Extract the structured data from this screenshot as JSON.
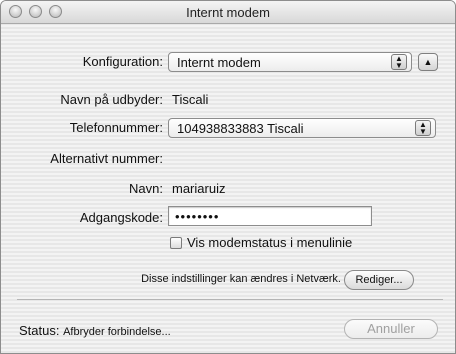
{
  "window": {
    "title": "Internt modem"
  },
  "configuration": {
    "label": "Konfiguration:",
    "value": "Internt modem"
  },
  "provider": {
    "label": "Navn på udbyder:",
    "value": "Tiscali"
  },
  "phone": {
    "label": "Telefonnummer:",
    "value": "104938833883  Tiscali"
  },
  "alt_number": {
    "label": "Alternativt nummer:"
  },
  "name": {
    "label": "Navn:",
    "value": "mariaruiz"
  },
  "password": {
    "label": "Adgangskode:",
    "value": "••••••••"
  },
  "modem_status_checkbox": {
    "label": "Vis modemstatus i menulinie",
    "checked": false
  },
  "network_note": {
    "text": "Disse indstillinger kan ændres i Netværk.",
    "button_label": "Rediger..."
  },
  "status": {
    "label": "Status:",
    "value": "Afbryder forbindelse..."
  },
  "cancel_button": {
    "label": "Annuller",
    "enabled": false
  }
}
